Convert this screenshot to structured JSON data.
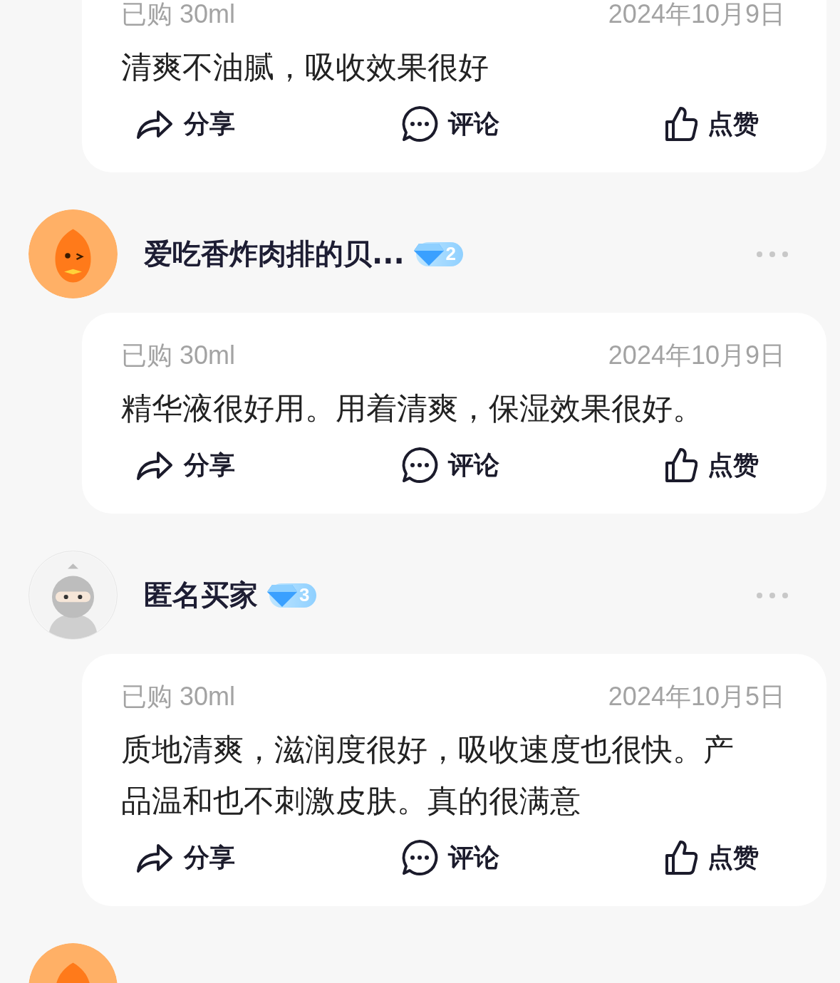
{
  "reviews": [
    {
      "card": {
        "purchased": "已购 30ml",
        "date": "2024年10月9日",
        "text": "清爽不油腻，吸收效果很好",
        "actions": [
          {
            "kind": "share",
            "label": "分享"
          },
          {
            "kind": "comment",
            "label": "评论"
          },
          {
            "kind": "like",
            "label": "点赞"
          }
        ]
      }
    },
    {
      "user": {
        "avatar": {
          "kind": "mascot"
        },
        "name": "爱吃香炸肉排的贝...",
        "level": "2"
      },
      "card": {
        "purchased": "已购 30ml",
        "date": "2024年10月9日",
        "text": "精华液很好用。用着清爽，保湿效果很好。",
        "actions": [
          {
            "kind": "share",
            "label": "分享"
          },
          {
            "kind": "comment",
            "label": "评论"
          },
          {
            "kind": "like",
            "label": "点赞"
          }
        ]
      }
    },
    {
      "user": {
        "avatar": {
          "kind": "anonymous"
        },
        "name": "匿名买家",
        "level": "3"
      },
      "card": {
        "purchased": "已购 30ml",
        "date": "2024年10月5日",
        "text": "质地清爽，滋润度很好，吸收速度也很快。产品温和也不刺激皮肤。真的很满意",
        "actions": [
          {
            "kind": "share",
            "label": "分享"
          },
          {
            "kind": "comment",
            "label": "评论"
          },
          {
            "kind": "like",
            "label": "点赞"
          }
        ]
      }
    },
    {
      "user": {
        "avatar": {
          "kind": "mascot"
        }
      }
    }
  ]
}
